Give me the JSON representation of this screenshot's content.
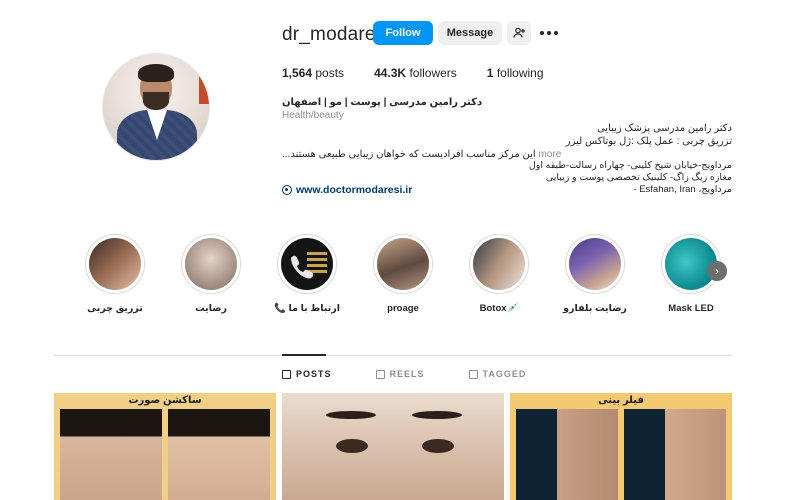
{
  "profile": {
    "username": "dr_modaresi",
    "follow_label": "Follow",
    "message_label": "Message",
    "posts_count": "1,564",
    "posts_label": "posts",
    "followers_count": "44.3K",
    "followers_label": "followers",
    "following_count": "1",
    "following_label": "following",
    "full_name": "دکتر رامین مدرسی | پوست | مو | اصفهان",
    "category": "Health/beauty",
    "bio_line1": "دکتر رامین مدرسی پزشک زیبایی",
    "bio_line2": "تزریق چربی : عمل پلک :ژل بوتاکس لیزر",
    "bio_line3": "این مرکز مناسب افرادیست که خواهان زیبایی طبیعی هستند...",
    "bio_more": "more",
    "address": "مرداویج-خیابان شیخ کلینی- چهاراه رسالت-طبقه اول مغازه زیگ زاگ- کلینیک تخصصی پوست و زیبایی مرداویج، Esfahan, Iran -",
    "website": "www.doctormodaresi.ir"
  },
  "highlights": [
    {
      "label": "تزریق چربی"
    },
    {
      "label": "رضایت"
    },
    {
      "label": "ارتباط با ما 📞"
    },
    {
      "label": "proage"
    },
    {
      "label": "Botox💉"
    },
    {
      "label": "رضایت بلفارو"
    },
    {
      "label": "Mask LED"
    }
  ],
  "tabs": [
    {
      "label": "POSTS",
      "icon": "grid-icon"
    },
    {
      "label": "REELS",
      "icon": "reels-icon"
    },
    {
      "label": "TAGGED",
      "icon": "tagged-icon"
    }
  ],
  "posts": [
    {
      "title": "ساکشن صورت"
    },
    {
      "title": ""
    },
    {
      "title": "فیلر بینی"
    }
  ],
  "colors": {
    "accent": "#0095f6",
    "link": "#00376b",
    "muted": "#8e8e8e"
  }
}
